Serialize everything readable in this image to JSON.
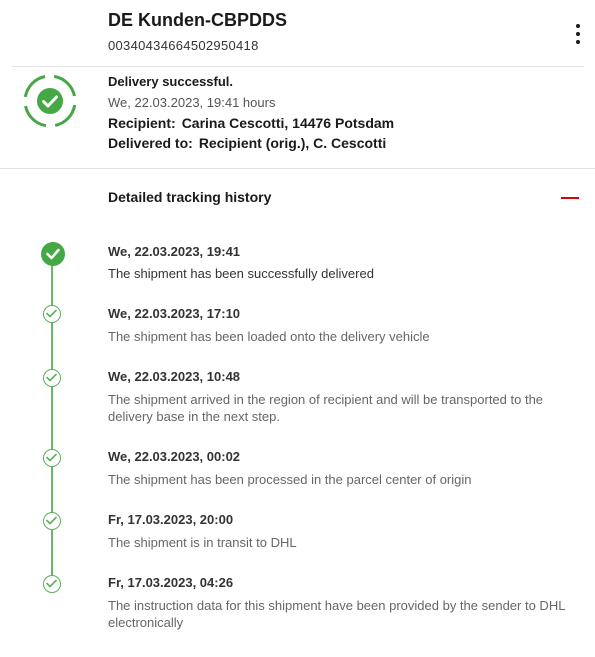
{
  "header": {
    "title": "DE Kunden-CBPDDS",
    "tracking_number": "00340434664502950418",
    "menu_icon": "more-vertical-icon"
  },
  "status": {
    "icon": "check-circle-icon",
    "title": "Delivery successful.",
    "time": "We, 22.03.2023, 19:41 hours",
    "recipient_label": "Recipient:",
    "recipient_value": "Carina Cescotti, 14476 Potsdam",
    "delivered_label": "Delivered to:",
    "delivered_value": "Recipient (orig.), C. Cescotti"
  },
  "history": {
    "title": "Detailed tracking history",
    "collapse_icon": "minus-icon",
    "events": [
      {
        "date": "We, 22.03.2023, 19:41",
        "description": "The shipment has been successfully delivered"
      },
      {
        "date": "We, 22.03.2023, 17:10",
        "description": "The shipment has been loaded onto the delivery vehicle"
      },
      {
        "date": "We, 22.03.2023, 10:48",
        "description": "The shipment arrived in the region of recipient and will be transported to the delivery base in the next step."
      },
      {
        "date": "We, 22.03.2023, 00:02",
        "description": "The shipment has been processed in the parcel center of origin"
      },
      {
        "date": "Fr, 17.03.2023, 20:00",
        "description": "The shipment is in transit to DHL"
      },
      {
        "date": "Fr, 17.03.2023, 04:26",
        "description": "The instruction data for this shipment have been provided by the sender to DHL electronically"
      }
    ]
  },
  "colors": {
    "success_green": "#45a845",
    "accent_red": "#d40511"
  }
}
